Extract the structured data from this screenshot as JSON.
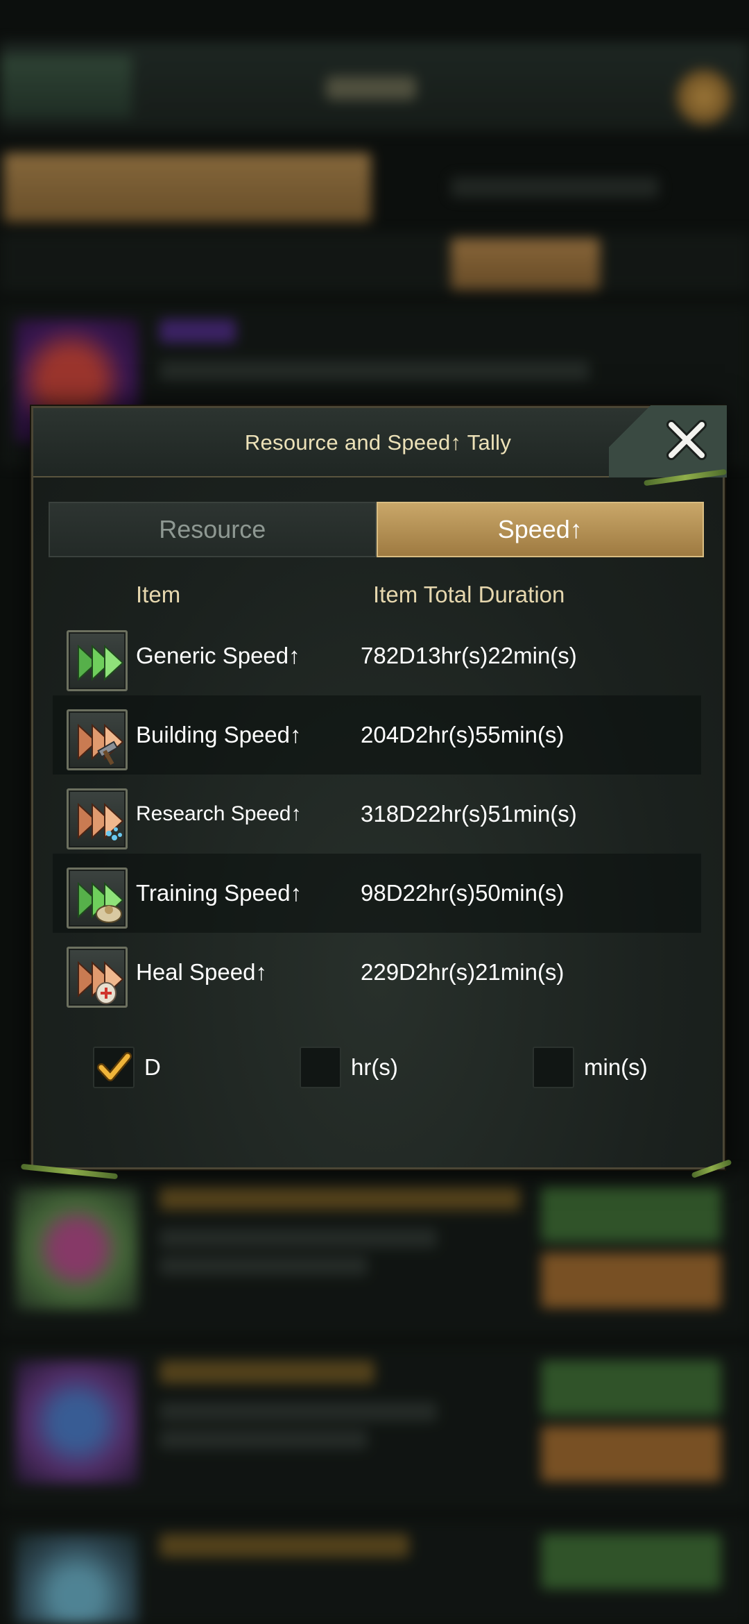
{
  "dialog": {
    "title": "Resource and Speed↑ Tally"
  },
  "tabs": [
    {
      "label": "Resource",
      "active": false
    },
    {
      "label": "Speed↑",
      "active": true
    }
  ],
  "columns": {
    "item": "Item",
    "duration": "Item Total Duration"
  },
  "rows": [
    {
      "name": "Generic Speed↑",
      "duration": "782D13hr(s)22min(s)",
      "icon": "generic-speedup-icon"
    },
    {
      "name": "Building Speed↑",
      "duration": "204D2hr(s)55min(s)",
      "icon": "building-speedup-icon"
    },
    {
      "name": "Research Speed↑",
      "duration": "318D22hr(s)51min(s)",
      "icon": "research-speedup-icon"
    },
    {
      "name": "Training Speed↑",
      "duration": "98D22hr(s)50min(s)",
      "icon": "training-speedup-icon"
    },
    {
      "name": "Heal Speed↑",
      "duration": "229D2hr(s)21min(s)",
      "icon": "heal-speedup-icon"
    }
  ],
  "units": [
    {
      "label": "D",
      "checked": true
    },
    {
      "label": "hr(s)",
      "checked": false
    },
    {
      "label": "min(s)",
      "checked": false
    }
  ],
  "colors": {
    "accent_gold": "#c9a769",
    "title_text": "#ece1b8",
    "check_orange": "#f0b53a"
  }
}
